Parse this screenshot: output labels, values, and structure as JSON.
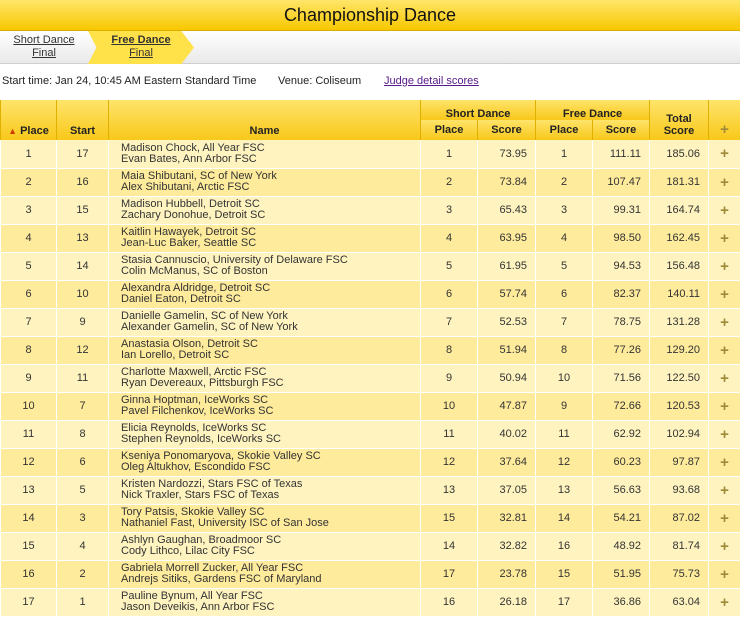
{
  "header": {
    "title": "Championship Dance"
  },
  "tabs": [
    {
      "label": "Short Dance",
      "sub": "Final"
    },
    {
      "label": "Free Dance",
      "sub": "Final"
    }
  ],
  "info": {
    "start_time": "Start time: Jan 24, 10:45 AM Eastern Standard Time",
    "venue": "Venue: Coliseum",
    "judge_link": "Judge detail scores"
  },
  "table": {
    "headers": {
      "place": "Place",
      "start": "Start",
      "name": "Name",
      "short_dance": "Short Dance",
      "free_dance": "Free Dance",
      "sub_place": "Place",
      "sub_score": "Score",
      "total_line1": "Total",
      "total_line2": "Score",
      "expand_icon": "plus-icon",
      "sort_icon": "double-chevron-up-icon"
    },
    "rows": [
      {
        "place": "1",
        "start": "17",
        "name1": "Madison Chock, All Year FSC",
        "name2": "Evan Bates, Ann Arbor FSC",
        "sd_place": "1",
        "sd_score": "73.95",
        "fd_place": "1",
        "fd_score": "111.11",
        "total": "185.06"
      },
      {
        "place": "2",
        "start": "16",
        "name1": "Maia Shibutani, SC of New York",
        "name2": "Alex Shibutani, Arctic FSC",
        "sd_place": "2",
        "sd_score": "73.84",
        "fd_place": "2",
        "fd_score": "107.47",
        "total": "181.31"
      },
      {
        "place": "3",
        "start": "15",
        "name1": "Madison Hubbell, Detroit SC",
        "name2": "Zachary Donohue, Detroit SC",
        "sd_place": "3",
        "sd_score": "65.43",
        "fd_place": "3",
        "fd_score": "99.31",
        "total": "164.74"
      },
      {
        "place": "4",
        "start": "13",
        "name1": "Kaitlin Hawayek, Detroit SC",
        "name2": "Jean-Luc Baker, Seattle SC",
        "sd_place": "4",
        "sd_score": "63.95",
        "fd_place": "4",
        "fd_score": "98.50",
        "total": "162.45"
      },
      {
        "place": "5",
        "start": "14",
        "name1": "Stasia Cannuscio, University of Delaware FSC",
        "name2": "Colin McManus, SC of Boston",
        "sd_place": "5",
        "sd_score": "61.95",
        "fd_place": "5",
        "fd_score": "94.53",
        "total": "156.48"
      },
      {
        "place": "6",
        "start": "10",
        "name1": "Alexandra Aldridge, Detroit SC",
        "name2": "Daniel Eaton, Detroit SC",
        "sd_place": "6",
        "sd_score": "57.74",
        "fd_place": "6",
        "fd_score": "82.37",
        "total": "140.11"
      },
      {
        "place": "7",
        "start": "9",
        "name1": "Danielle Gamelin, SC of New York",
        "name2": "Alexander Gamelin, SC of New York",
        "sd_place": "7",
        "sd_score": "52.53",
        "fd_place": "7",
        "fd_score": "78.75",
        "total": "131.28"
      },
      {
        "place": "8",
        "start": "12",
        "name1": "Anastasia Olson, Detroit SC",
        "name2": "Ian Lorello, Detroit SC",
        "sd_place": "8",
        "sd_score": "51.94",
        "fd_place": "8",
        "fd_score": "77.26",
        "total": "129.20"
      },
      {
        "place": "9",
        "start": "11",
        "name1": "Charlotte Maxwell, Arctic FSC",
        "name2": "Ryan Devereaux, Pittsburgh FSC",
        "sd_place": "9",
        "sd_score": "50.94",
        "fd_place": "10",
        "fd_score": "71.56",
        "total": "122.50"
      },
      {
        "place": "10",
        "start": "7",
        "name1": "Ginna Hoptman, IceWorks SC",
        "name2": "Pavel Filchenkov, IceWorks SC",
        "sd_place": "10",
        "sd_score": "47.87",
        "fd_place": "9",
        "fd_score": "72.66",
        "total": "120.53"
      },
      {
        "place": "11",
        "start": "8",
        "name1": "Elicia Reynolds, IceWorks SC",
        "name2": "Stephen Reynolds, IceWorks SC",
        "sd_place": "11",
        "sd_score": "40.02",
        "fd_place": "11",
        "fd_score": "62.92",
        "total": "102.94"
      },
      {
        "place": "12",
        "start": "6",
        "name1": "Kseniya Ponomaryova, Skokie Valley SC",
        "name2": "Oleg Altukhov, Escondido FSC",
        "sd_place": "12",
        "sd_score": "37.64",
        "fd_place": "12",
        "fd_score": "60.23",
        "total": "97.87"
      },
      {
        "place": "13",
        "start": "5",
        "name1": "Kristen Nardozzi, Stars FSC of Texas",
        "name2": "Nick Traxler, Stars FSC of Texas",
        "sd_place": "13",
        "sd_score": "37.05",
        "fd_place": "13",
        "fd_score": "56.63",
        "total": "93.68"
      },
      {
        "place": "14",
        "start": "3",
        "name1": "Tory Patsis, Skokie Valley SC",
        "name2": "Nathaniel Fast, University ISC of San Jose",
        "sd_place": "15",
        "sd_score": "32.81",
        "fd_place": "14",
        "fd_score": "54.21",
        "total": "87.02"
      },
      {
        "place": "15",
        "start": "4",
        "name1": "Ashlyn Gaughan, Broadmoor SC",
        "name2": "Cody Lithco, Lilac City FSC",
        "sd_place": "14",
        "sd_score": "32.82",
        "fd_place": "16",
        "fd_score": "48.92",
        "total": "81.74"
      },
      {
        "place": "16",
        "start": "2",
        "name1": "Gabriela Morrell Zucker, All Year FSC",
        "name2": "Andrejs Sitiks, Gardens FSC of Maryland",
        "sd_place": "17",
        "sd_score": "23.78",
        "fd_place": "15",
        "fd_score": "51.95",
        "total": "75.73"
      },
      {
        "place": "17",
        "start": "1",
        "name1": "Pauline Bynum, All Year FSC",
        "name2": "Jason Deveikis, Ann Arbor FSC",
        "sd_place": "16",
        "sd_score": "26.18",
        "fd_place": "17",
        "fd_score": "36.86",
        "total": "63.04"
      }
    ]
  }
}
